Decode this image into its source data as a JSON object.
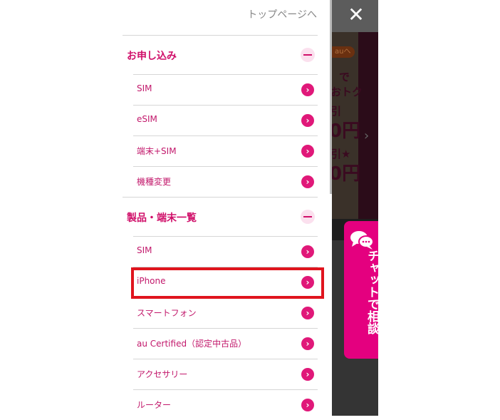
{
  "header": {
    "top_link": "トップページへ",
    "close_icon": "close-icon"
  },
  "sections": [
    {
      "title": "お申し込み",
      "items": [
        {
          "label": "SIM"
        },
        {
          "label": "eSIM"
        },
        {
          "label": "端末+SIM"
        },
        {
          "label": "機種変更"
        }
      ]
    },
    {
      "title": "製品・端末一覧",
      "items": [
        {
          "label": "SIM"
        },
        {
          "label": "iPhone"
        },
        {
          "label": "スマートフォン"
        },
        {
          "label": "au Certified（認定中古品）"
        },
        {
          "label": "アクセサリー"
        },
        {
          "label": "ルーター"
        }
      ]
    }
  ],
  "background": {
    "pill": "auへ",
    "t1": "で",
    "t2": "おトク",
    "t3": "引",
    "t4": "0円",
    "t5": "引★",
    "t6": "0円"
  },
  "chat": {
    "label": "チャットで相談",
    "icon": "chat-bubble-icon"
  },
  "highlight": {
    "target": "iPhone",
    "color": "#e0141e"
  },
  "colors": {
    "accent": "#e4007f",
    "text": "#c2186b"
  }
}
